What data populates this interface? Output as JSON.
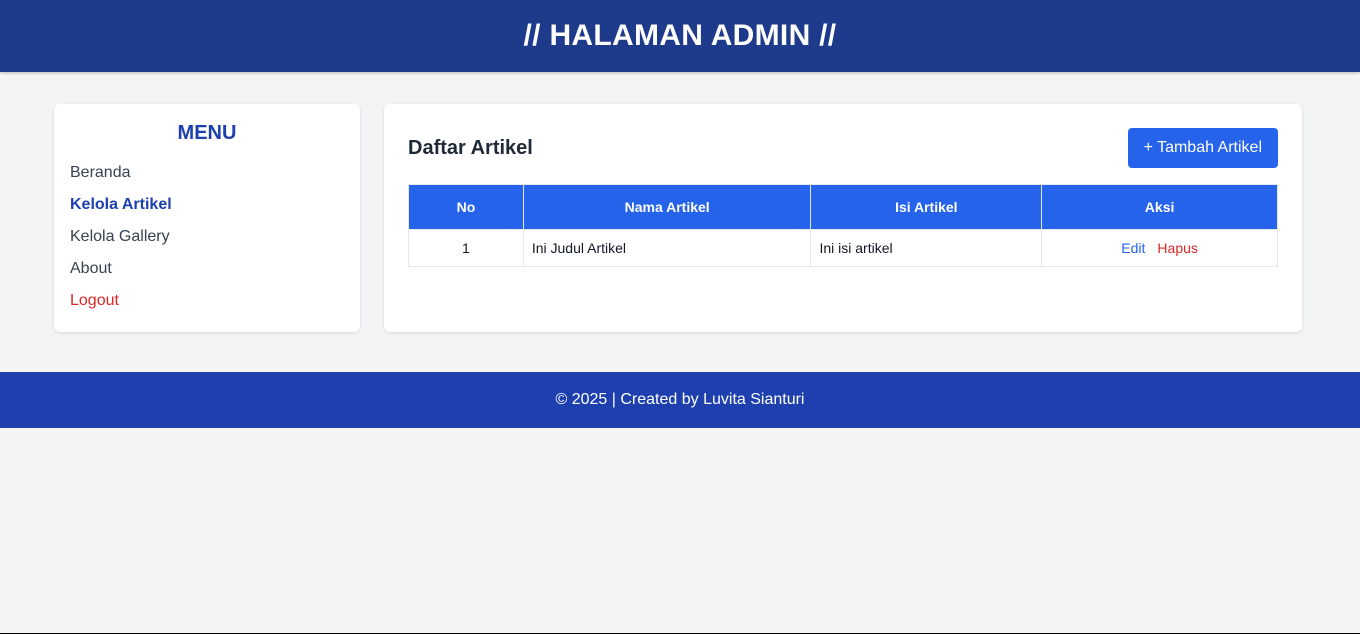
{
  "header": {
    "title": "// HALAMAN ADMIN //"
  },
  "sidebar": {
    "title": "MENU",
    "items": [
      {
        "label": "Beranda"
      },
      {
        "label": "Kelola Artikel"
      },
      {
        "label": "Kelola Gallery"
      },
      {
        "label": "About"
      },
      {
        "label": "Logout"
      }
    ]
  },
  "content": {
    "title": "Daftar Artikel",
    "add_button": "+ Tambah Artikel",
    "table": {
      "headers": [
        "No",
        "Nama Artikel",
        "Isi Artikel",
        "Aksi"
      ],
      "rows": [
        {
          "no": "1",
          "nama": "Ini Judul Artikel",
          "isi": "Ini isi artikel",
          "edit": "Edit",
          "hapus": "Hapus"
        }
      ]
    }
  },
  "footer": {
    "text": "© 2025 | Created by Luvita Sianturi"
  },
  "colors": {
    "header_bg": "#1e3a8a",
    "footer_bg": "#1e40af",
    "accent": "#2563eb",
    "danger": "#dc2626",
    "page_bg": "#f3f4f6"
  }
}
